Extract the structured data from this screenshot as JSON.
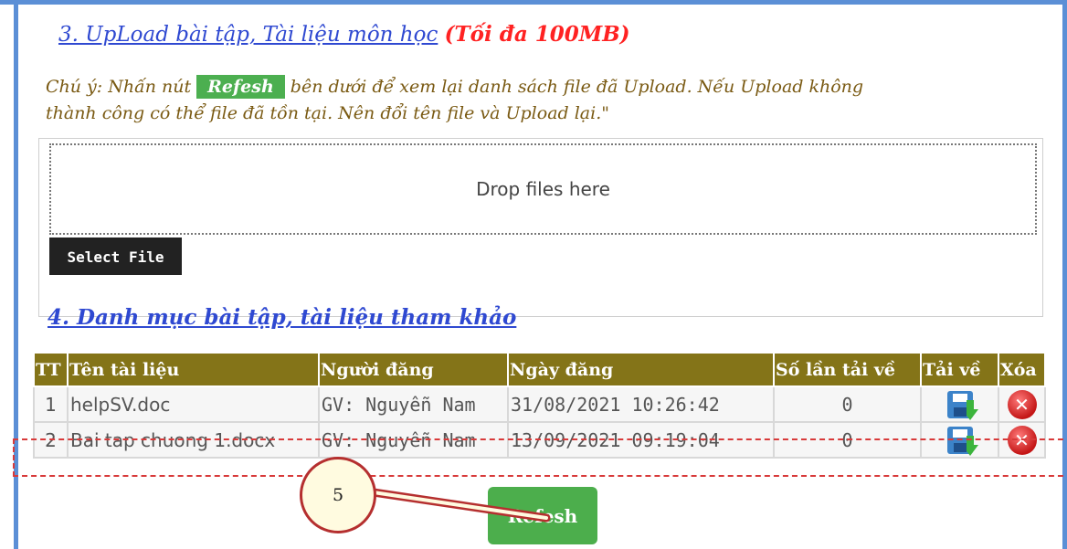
{
  "section3": {
    "title_link": "3. UpLoad bài tập, Tài liệu môn học",
    "title_limit": "(Tối đa 100MB)"
  },
  "note": {
    "prefix": "Chú ý: Nhấn nút",
    "button_label": "Refesh",
    "suffix": "bên dưới để xem lại danh sách file đã Upload. Nếu Upload không",
    "line2": "thành công có thể file đã tồn tại. Nên đổi tên file và Upload lại.\""
  },
  "upload": {
    "drop_text": "Drop files here",
    "select_label": "Select File"
  },
  "section4": {
    "title": "4. Danh mục bài tập, tài liệu tham khảo"
  },
  "table": {
    "headers": [
      "TT",
      "Tên tài liệu",
      "Người đăng",
      "Ngày đăng",
      "Số lần tải về",
      "Tải về",
      "Xóa"
    ],
    "rows": [
      {
        "tt": "1",
        "name": "helpSV.doc",
        "poster": "GV: Nguyễn Nam",
        "date": "31/08/2021 10:26:42",
        "downloads": "0"
      },
      {
        "tt": "2",
        "name": "Bai tap chuong 1.docx",
        "poster": "GV: Nguyễn Nam",
        "date": "13/09/2021 09:19:04",
        "downloads": "0"
      }
    ],
    "download_icon": "floppy-download-icon",
    "delete_icon": "delete-x-icon"
  },
  "refresh_button": "Refesh",
  "callout_number": "5",
  "colors": {
    "frame": "#5b8fd6",
    "header_bg": "#847418",
    "accent_green": "#4caf50",
    "link_blue": "#2f49d1",
    "limit_red": "#ff2222",
    "note_brown": "#7a5a13",
    "annotation_red": "#d83a3a"
  }
}
